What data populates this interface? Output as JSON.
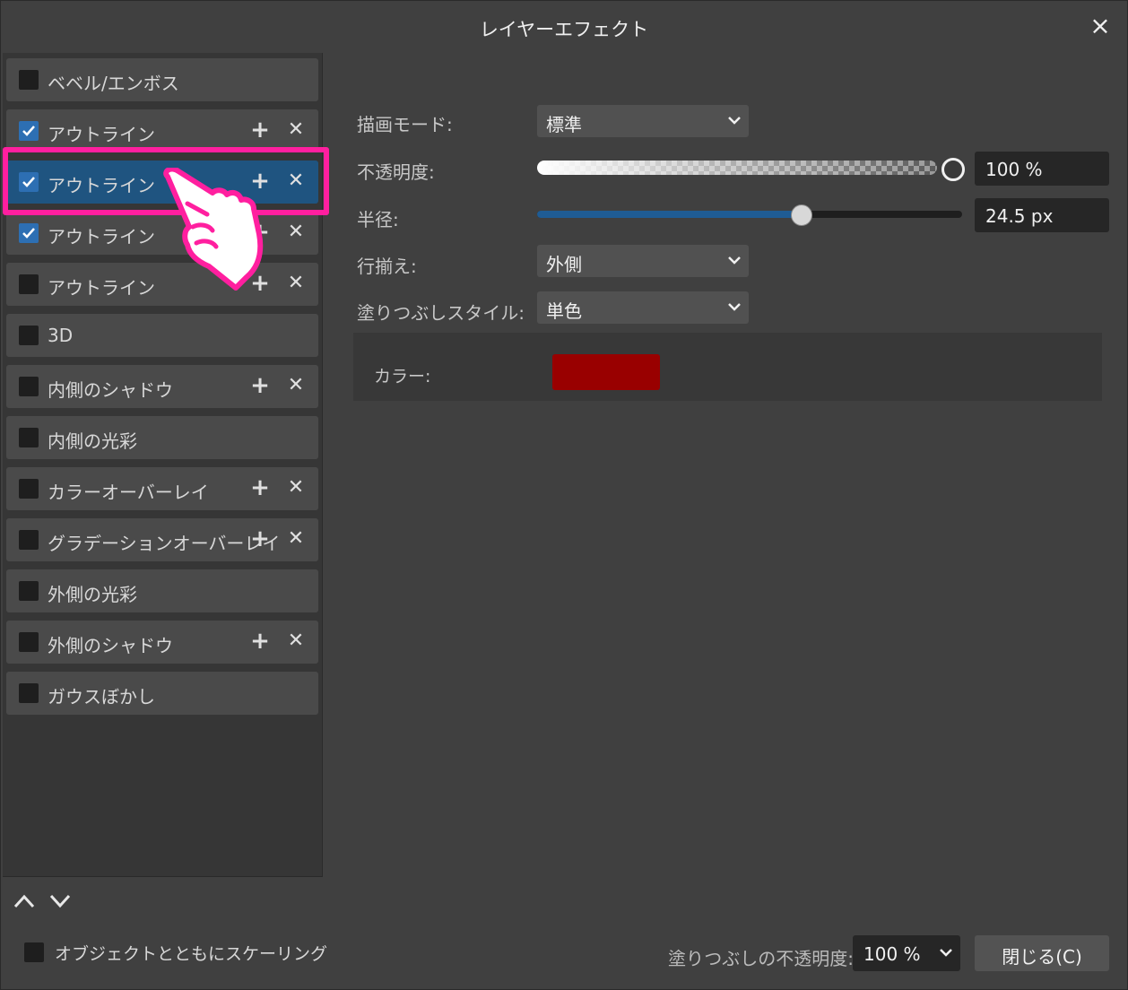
{
  "window": {
    "title": "レイヤーエフェクト",
    "close_icon": "×"
  },
  "effects": [
    {
      "label": "ベベル/エンボス",
      "checked": false,
      "has_controls": false
    },
    {
      "label": "アウトライン",
      "checked": true,
      "has_controls": true
    },
    {
      "label": "アウトライン",
      "checked": true,
      "has_controls": true,
      "selected": true
    },
    {
      "label": "アウトライン",
      "checked": true,
      "has_controls": true
    },
    {
      "label": "アウトライン",
      "checked": false,
      "has_controls": true
    },
    {
      "label": "3D",
      "checked": false,
      "has_controls": false
    },
    {
      "label": "内側のシャドウ",
      "checked": false,
      "has_controls": true
    },
    {
      "label": "内側の光彩",
      "checked": false,
      "has_controls": false
    },
    {
      "label": "カラーオーバーレイ",
      "checked": false,
      "has_controls": true
    },
    {
      "label": "グラデーションオーバーレイ",
      "checked": false,
      "has_controls": true
    },
    {
      "label": "外側の光彩",
      "checked": false,
      "has_controls": false
    },
    {
      "label": "外側のシャドウ",
      "checked": false,
      "has_controls": true
    },
    {
      "label": "ガウスぼかし",
      "checked": false,
      "has_controls": false
    }
  ],
  "effect_controls": {
    "add_glyph": "+",
    "remove_glyph": "✕"
  },
  "props": {
    "blend_mode": {
      "label": "描画モード:",
      "value": "標準"
    },
    "opacity": {
      "label": "不透明度:",
      "value": "100 %",
      "level": 1.0
    },
    "radius": {
      "label": "半径:",
      "value": "24.5 px",
      "level": 0.62
    },
    "alignment": {
      "label": "行揃え:",
      "value": "外側"
    },
    "fill_style": {
      "label": "塗りつぶしスタイル:",
      "value": "単色"
    },
    "color": {
      "label": "カラー:",
      "swatch": "#990000"
    }
  },
  "footer": {
    "scale_with_object": "オブジェクトとともにスケーリング",
    "fill_opacity_label": "塗りつぶしの不透明度:",
    "fill_opacity_value": "100 %",
    "close_button": "閉じる(C)"
  },
  "annotation": {
    "highlight_color": "#ff1f9f"
  }
}
